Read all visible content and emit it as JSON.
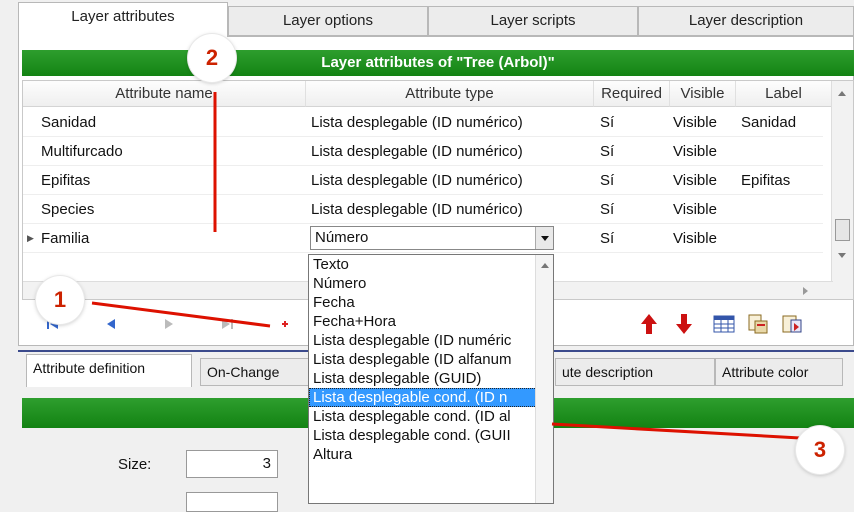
{
  "top_tabs": [
    {
      "label": "Layer attributes",
      "active": true
    },
    {
      "label": "Layer options",
      "active": false
    },
    {
      "label": "Layer scripts",
      "active": false
    },
    {
      "label": "Layer description",
      "active": false
    }
  ],
  "panel_title": "Layer attributes of \"Tree (Arbol)\"",
  "grid": {
    "columns": [
      "Attribute name",
      "Attribute type",
      "Required",
      "Visible",
      "Label"
    ],
    "rows": [
      {
        "name": "Sanidad",
        "type": "Lista desplegable (ID numérico)",
        "required": "Sí",
        "visible": "Visible",
        "label": "Sanidad"
      },
      {
        "name": "Multifurcado",
        "type": "Lista desplegable (ID numérico)",
        "required": "Sí",
        "visible": "Visible",
        "label": ""
      },
      {
        "name": "Epifitas",
        "type": "Lista desplegable (ID numérico)",
        "required": "Sí",
        "visible": "Visible",
        "label": "Epifitas"
      },
      {
        "name": "Species",
        "type": "Lista desplegable (ID numérico)",
        "required": "Sí",
        "visible": "Visible",
        "label": ""
      },
      {
        "name": "Familia",
        "type": "Número",
        "required": "Sí",
        "visible": "Visible",
        "label": "",
        "editing": true
      }
    ]
  },
  "type_dropdown": {
    "options": [
      "Texto",
      "Número",
      "Fecha",
      "Fecha+Hora",
      "Lista desplegable (ID numéric",
      "Lista desplegable (ID alfanum",
      "Lista desplegable (GUID)",
      "Lista desplegable cond. (ID n",
      "Lista desplegable cond. (ID al",
      "Lista desplegable cond. (GUII",
      "Altura"
    ],
    "selected_index": 7
  },
  "bottom_tabs": [
    "Attribute definition",
    "On-Change",
    "ute description",
    "Attribute color"
  ],
  "size_field": {
    "label": "Size:",
    "value": "3"
  },
  "callouts": [
    "1",
    "2",
    "3"
  ],
  "colors": {
    "header_green": "#138313",
    "annotation_red": "#dd1100",
    "selection_blue": "#3399ff",
    "divider_navy": "#3b4a8c"
  }
}
